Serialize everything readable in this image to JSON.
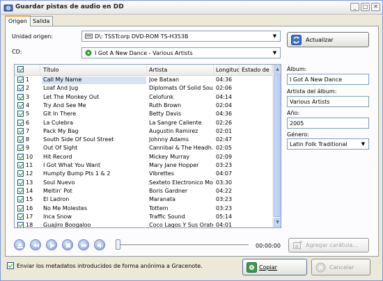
{
  "window": {
    "title": "Guardar pistas de audio en DD",
    "controls": [
      "_",
      "□",
      "✕"
    ]
  },
  "tabs": [
    {
      "label": "Origen",
      "active": true
    },
    {
      "label": "Salida",
      "active": false
    }
  ],
  "source": {
    "drive_label": "Unidad origen:",
    "drive_value": "D\\: TSSTcorp DVD-ROM TS-H353B",
    "cd_label": "CD:",
    "cd_value": "I Got A New Dance - Various Artists",
    "refresh_label": "Actualizar"
  },
  "tracklist": {
    "columns": [
      "",
      "Título",
      "Artista",
      "Longitud",
      "Estado de l..."
    ],
    "rows": [
      {
        "num": "1",
        "title": "Call My Name",
        "artist": "Joe Bataan",
        "length": "04:36"
      },
      {
        "num": "2",
        "title": "Loaf And Jug",
        "artist": "Diplomats Of Solid Sound",
        "length": "02:06"
      },
      {
        "num": "3",
        "title": "Let The Monkey Out",
        "artist": "Celofunk",
        "length": "04:14"
      },
      {
        "num": "4",
        "title": "Try And See Me",
        "artist": "Ruth Brown",
        "length": "02:04"
      },
      {
        "num": "5",
        "title": "Git In There",
        "artist": "Betty Davis",
        "length": "04:36"
      },
      {
        "num": "6",
        "title": "La Culebra",
        "artist": "La Sangre Caliente",
        "length": "02:26"
      },
      {
        "num": "7",
        "title": "Pack My Bag",
        "artist": "Augustin Ramirez",
        "length": "02:01"
      },
      {
        "num": "8",
        "title": "South Side Of Soul Street",
        "artist": "Johnny Adams",
        "length": "02:47"
      },
      {
        "num": "9",
        "title": "Out Of Sight",
        "artist": "Cannibal & The Headh...",
        "length": "02:05"
      },
      {
        "num": "10",
        "title": "Hit Record",
        "artist": "Mickey Murray",
        "length": "02:09"
      },
      {
        "num": "11",
        "title": "I Got What You Want",
        "artist": "Mary Jane Hopper",
        "length": "03:23"
      },
      {
        "num": "12",
        "title": "Humpty Bump Pts 1 & 2",
        "artist": "Vibrettes",
        "length": "04:07"
      },
      {
        "num": "13",
        "title": "Soul Nuevo",
        "artist": "Sexteto Electronico Mo...",
        "length": "03:30"
      },
      {
        "num": "14",
        "title": "Meltin' Pot",
        "artist": "Boris Gardner",
        "length": "04:22"
      },
      {
        "num": "15",
        "title": "El Ladron",
        "artist": "Maranata",
        "length": "03:23"
      },
      {
        "num": "16",
        "title": "No Me Molestes",
        "artist": "Tottem",
        "length": "03:23"
      },
      {
        "num": "17",
        "title": "Inca Snow",
        "artist": "Traffic Sound",
        "length": "05:14"
      },
      {
        "num": "18",
        "title": "Guajiro Boogaloo",
        "artist": "Coco Lagos Y Sus Orates",
        "length": "04:01"
      }
    ]
  },
  "album_info": {
    "album_label": "Álbum:",
    "album_value": "I Got A New Dance",
    "album_artist_label": "Artista del álbum:",
    "album_artist_value": "Various Artists",
    "year_label": "Año:",
    "year_value": "2005",
    "genre_label": "Género:",
    "genre_value": "Latin Folk  Traditional"
  },
  "player": {
    "time": "00:00:00",
    "add_cover_label": "Agregar carátula..."
  },
  "footer": {
    "anonymous_label": "Enviar los metadatos introducidos de forma anónima a Gracenote.",
    "copy_label": "Copiar",
    "cancel_label": "Cancelar"
  },
  "colors": {
    "window_bg": "#ece9d8",
    "selection": "#d5e3f4",
    "check_green": "#21a121",
    "accent_blue": "#3a6fc2"
  }
}
